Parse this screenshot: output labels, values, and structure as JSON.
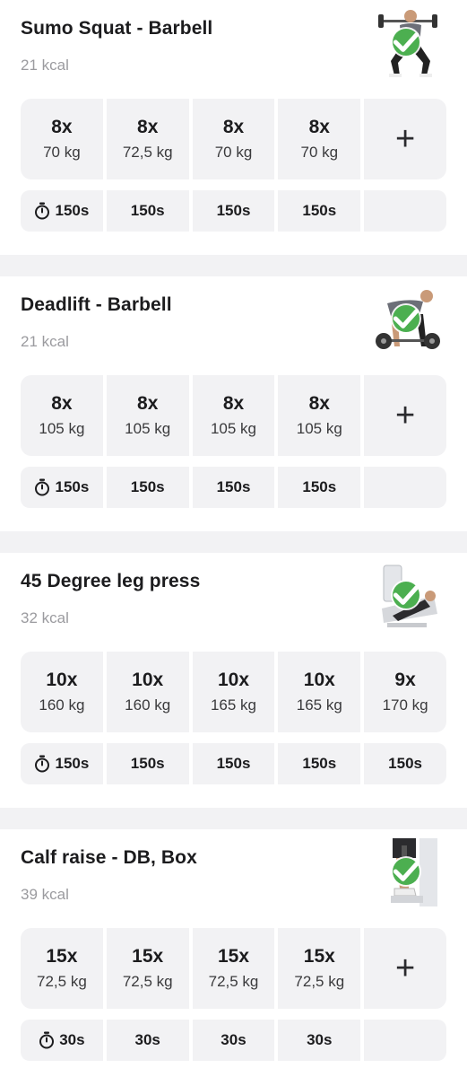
{
  "colors": {
    "accent_check": "#4caf50",
    "cell_bg": "#f2f2f4",
    "divider": "#f2f2f4"
  },
  "exercises": [
    {
      "title": "Sumo Squat - Barbell",
      "kcal": "21 kcal",
      "thumbnail_icon": "squat-figure-icon",
      "sets": [
        {
          "reps": "8x",
          "weight": "70 kg"
        },
        {
          "reps": "8x",
          "weight": "72,5 kg"
        },
        {
          "reps": "8x",
          "weight": "70 kg"
        },
        {
          "reps": "8x",
          "weight": "70 kg"
        }
      ],
      "add_label": "+",
      "rest": [
        "150s",
        "150s",
        "150s",
        "150s",
        ""
      ]
    },
    {
      "title": "Deadlift - Barbell",
      "kcal": "21 kcal",
      "thumbnail_icon": "deadlift-figure-icon",
      "sets": [
        {
          "reps": "8x",
          "weight": "105 kg"
        },
        {
          "reps": "8x",
          "weight": "105 kg"
        },
        {
          "reps": "8x",
          "weight": "105 kg"
        },
        {
          "reps": "8x",
          "weight": "105 kg"
        }
      ],
      "add_label": "+",
      "rest": [
        "150s",
        "150s",
        "150s",
        "150s",
        ""
      ]
    },
    {
      "title": "45 Degree leg press",
      "kcal": "32 kcal",
      "thumbnail_icon": "leg-press-figure-icon",
      "sets": [
        {
          "reps": "10x",
          "weight": "160 kg"
        },
        {
          "reps": "10x",
          "weight": "160 kg"
        },
        {
          "reps": "10x",
          "weight": "165 kg"
        },
        {
          "reps": "10x",
          "weight": "165 kg"
        },
        {
          "reps": "9x",
          "weight": "170 kg"
        }
      ],
      "rest": [
        "150s",
        "150s",
        "150s",
        "150s",
        "150s"
      ]
    },
    {
      "title": "Calf raise - DB, Box",
      "kcal": "39 kcal",
      "thumbnail_icon": "calf-raise-figure-icon",
      "sets": [
        {
          "reps": "15x",
          "weight": "72,5 kg"
        },
        {
          "reps": "15x",
          "weight": "72,5 kg"
        },
        {
          "reps": "15x",
          "weight": "72,5 kg"
        },
        {
          "reps": "15x",
          "weight": "72,5 kg"
        }
      ],
      "add_label": "+",
      "rest": [
        "30s",
        "30s",
        "30s",
        "30s",
        ""
      ]
    }
  ]
}
